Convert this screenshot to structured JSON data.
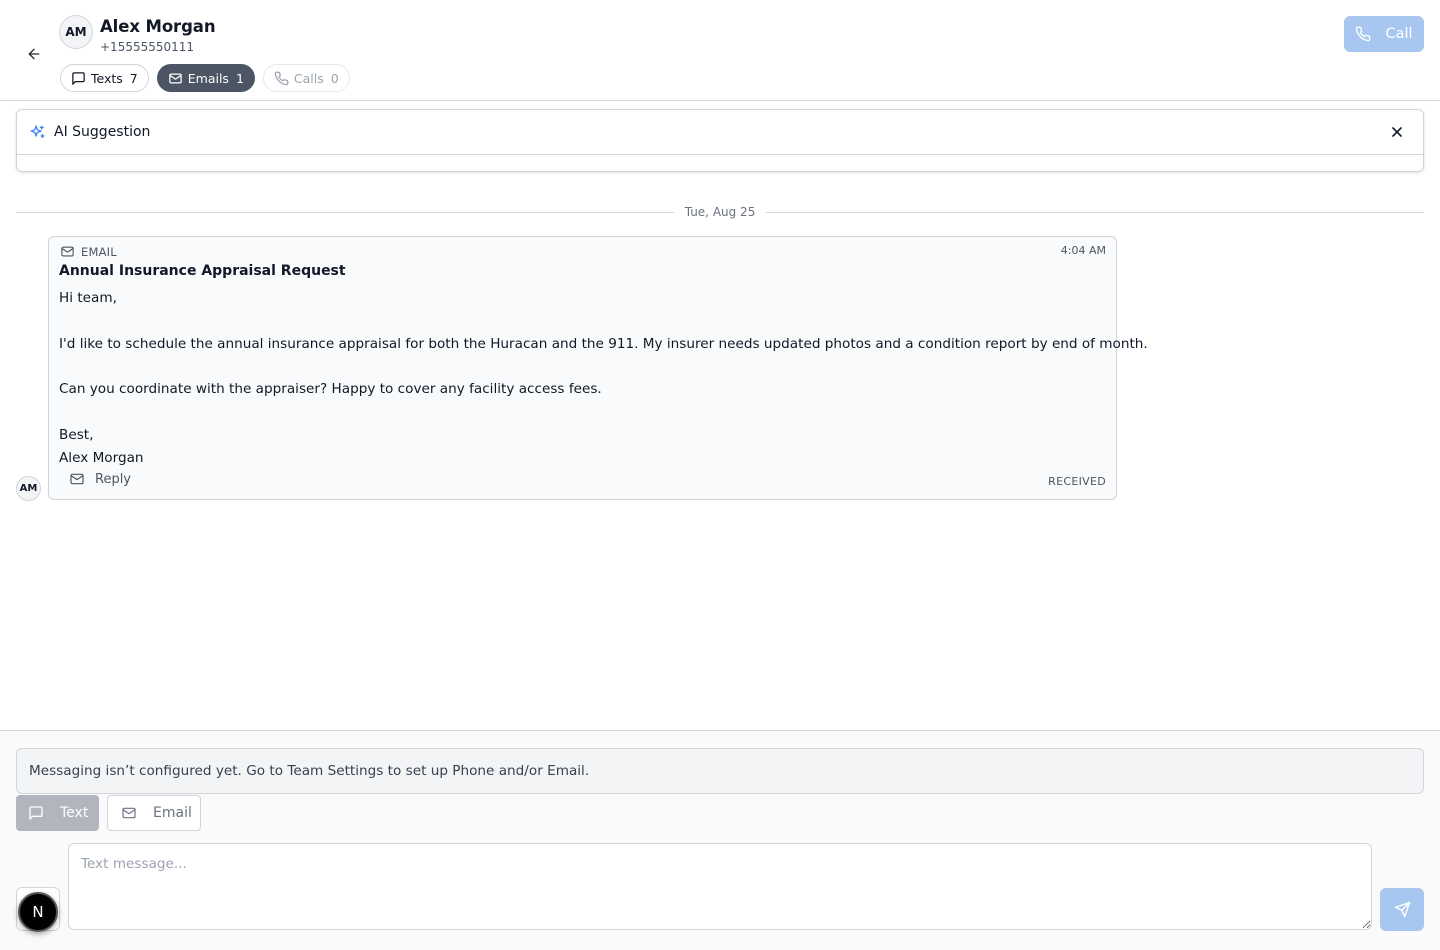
{
  "header": {
    "avatar_initials": "AM",
    "contact_name": "Alex Morgan",
    "contact_phone": "+15555550111",
    "tabs": [
      {
        "label": "Texts",
        "count": "7",
        "icon": "message-square-icon"
      },
      {
        "label": "Emails",
        "count": "1",
        "icon": "mail-icon"
      },
      {
        "label": "Calls",
        "count": "0",
        "icon": "phone-icon"
      }
    ],
    "call_label": "Call"
  },
  "ai_suggestion": {
    "title": "AI Suggestion",
    "icon": "sparkles-icon"
  },
  "thread": {
    "date_label": "Tue, Aug 25",
    "message": {
      "avatar_initials": "AM",
      "type_label": "EMAIL",
      "time": "4:04 AM",
      "subject": "Annual Insurance Appraisal Request",
      "body_lines": [
        "Hi team,",
        "",
        "I'd like to schedule the annual insurance appraisal for both the Huracan and the 911. My insurer needs updated photos and a condition report by end of month.",
        "",
        "Can you coordinate with the appraiser? Happy to cover any facility access fees.",
        "",
        "Best,",
        "Alex Morgan"
      ],
      "reply_label": "Reply",
      "status": "RECEIVED"
    }
  },
  "composer": {
    "notice": "Messaging isn’t configured yet. Go to Team Settings to set up Phone and/or Email.",
    "channel_text_label": "Text",
    "channel_email_label": "Email",
    "input_placeholder": "Text message...",
    "badge_letter": "N"
  },
  "colors": {
    "accent_disabled": "#a8c7f0",
    "active_pill": "#4b5563",
    "sparkle": "#3b82f6"
  }
}
